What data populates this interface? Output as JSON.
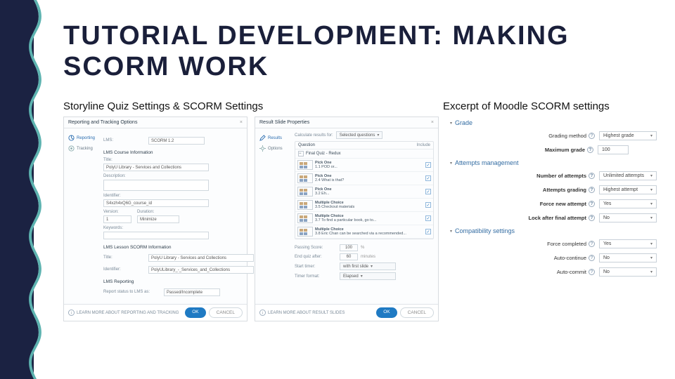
{
  "title": "TUTORIAL DEVELOPMENT: MAKING SCORM WORK",
  "captions": {
    "left": "Storyline Quiz Settings & SCORM Settings",
    "right": "Excerpt of Moodle SCORM settings"
  },
  "panelA": {
    "header": "Reporting and Tracking Options",
    "close": "×",
    "sidebar": [
      {
        "icon": "graph-icon",
        "label": "Reporting"
      },
      {
        "icon": "target-icon",
        "label": "Tracking"
      }
    ],
    "lms_label": "LMS:",
    "lms_value": "SCORM 1.2",
    "course_section": "LMS Course Information",
    "fields": {
      "title_label": "Title:",
      "title_value": "PolyU Library - Services and Collections",
      "description_label": "Description:",
      "description_value": "",
      "identifier_label": "Identifier:",
      "identifier_value": "S4xzh4xQ6G_course_id",
      "version_label": "Version:",
      "version_value": "1",
      "duration_label": "Duration:",
      "duration_value": "Minimize",
      "keywords_label": "Keywords:",
      "keywords_value": ""
    },
    "lesson_section": "LMS Lesson SCORM Information",
    "lesson": {
      "title_label": "Title:",
      "title_value": "PolyU Library - Services and Collections",
      "identifier_label": "Identifier:",
      "identifier_value": "PolyULibrary_-_Services_and_Collections"
    },
    "reporting_section": "LMS Reporting",
    "reporting": {
      "status_label": "Report status to LMS as:",
      "status_value": "Passed/Incomplete"
    },
    "footer": {
      "learn": "LEARN MORE ABOUT REPORTING AND TRACKING",
      "ok": "OK",
      "cancel": "CANCEL"
    }
  },
  "panelB": {
    "header": "Result Slide Properties",
    "close": "×",
    "sidebar": [
      {
        "icon": "pencil-icon",
        "label": "Results"
      },
      {
        "icon": "gear-icon",
        "label": "Options"
      }
    ],
    "calc_label": "Calculate results for:",
    "calc_value": "Selected questions",
    "questions_header": "Question",
    "include_header": "Include",
    "final_label": "Final Quiz - Redux",
    "questions": [
      {
        "title": "Pick One",
        "sub": "1.1 POD or..."
      },
      {
        "title": "Pick One",
        "sub": "2.4 What is that?"
      },
      {
        "title": "Pick One",
        "sub": "3.2 Eh..."
      },
      {
        "title": "Multiple Choice",
        "sub": "3.5 Checkout materials"
      },
      {
        "title": "Multiple Choice",
        "sub": "3.7 To find a particular book, go to..."
      },
      {
        "title": "Multiple Choice",
        "sub": "3.8 Eric Chan can be searched via a recommended..."
      }
    ],
    "passing_label": "Passing Score:",
    "passing_value": "100",
    "passing_unit": "%",
    "endafter_label": "End quiz after:",
    "endafter_value": "60",
    "endafter_unit": "minutes",
    "starttimer_label": "Start timer:",
    "starttimer_value": "with first slide",
    "timerformat_label": "Timer format:",
    "timerformat_value": "Elapsed",
    "footer": {
      "learn": "LEARN MORE ABOUT RESULT SLIDES",
      "ok": "OK",
      "cancel": "CANCEL"
    }
  },
  "panelC": {
    "sections": {
      "grade": "Grade",
      "attempts": "Attempts management",
      "compat": "Compatibility settings"
    },
    "grade": {
      "method_label": "Grading method",
      "method_value": "Highest grade",
      "max_label": "Maximum grade",
      "max_value": "100"
    },
    "attempts": {
      "num_label": "Number of attempts",
      "num_value": "Unlimited attempts",
      "grading_label": "Attempts grading",
      "grading_value": "Highest attempt",
      "force_label": "Force new attempt",
      "force_value": "Yes",
      "lock_label": "Lock after final attempt",
      "lock_value": "No"
    },
    "compat": {
      "forcecomp_label": "Force completed",
      "forcecomp_value": "Yes",
      "autocont_label": "Auto-continue",
      "autocont_value": "No",
      "autocommit_label": "Auto-commit",
      "autocommit_value": "No"
    }
  }
}
